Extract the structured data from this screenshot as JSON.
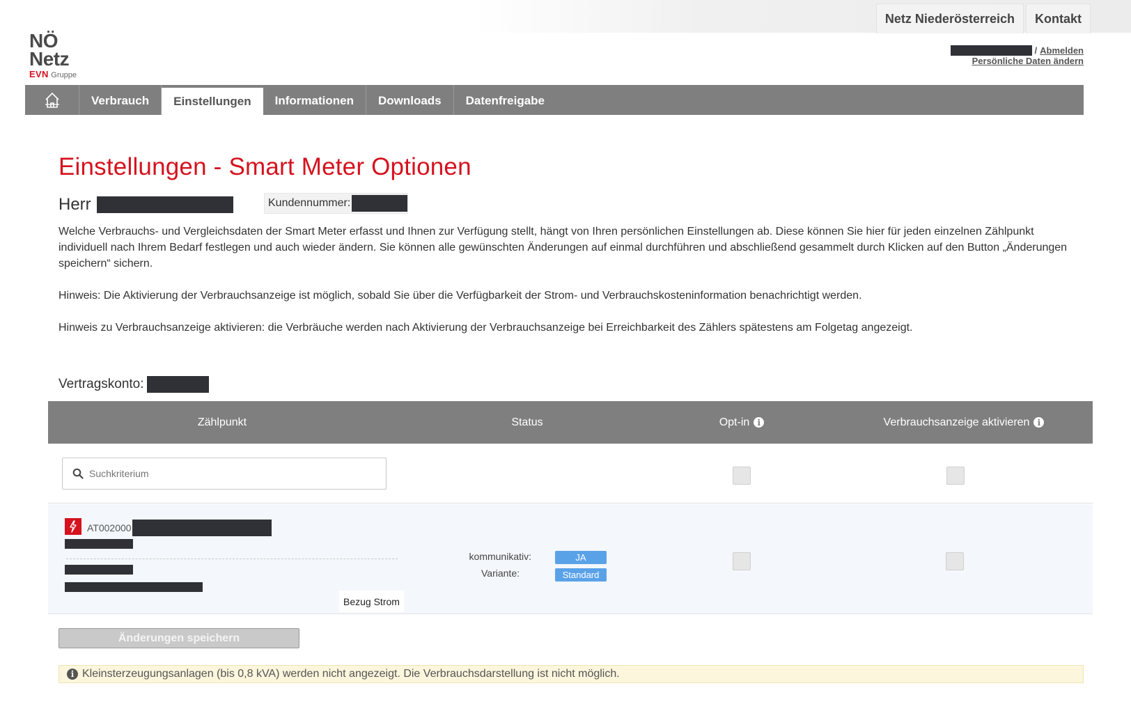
{
  "toplinks": [
    "Netz Niederösterreich",
    "Kontakt"
  ],
  "logo": {
    "line1": "NÖ",
    "line2": "Netz",
    "brand": "EVN",
    "brand_suffix": "Gruppe"
  },
  "user": {
    "logout": "Abmelden",
    "edit_data": "Persönliche Daten ändern",
    "separator": "/"
  },
  "nav": {
    "home_icon": "home-icon",
    "items": [
      {
        "label": "Verbrauch",
        "active": false
      },
      {
        "label": "Einstellungen",
        "active": true
      },
      {
        "label": "Informationen",
        "active": false
      },
      {
        "label": "Downloads",
        "active": false
      },
      {
        "label": "Datenfreigabe",
        "active": false
      }
    ]
  },
  "page": {
    "title": "Einstellungen - Smart Meter Optionen",
    "salutation": "Herr",
    "customer_number_label": "Kundennummer:",
    "intro": [
      "Welche Verbrauchs- und Vergleichsdaten der Smart Meter erfasst und Ihnen zur Verfügung stellt, hängt von Ihren persönlichen Einstellungen ab. Diese können Sie hier für jeden einzelnen Zählpunkt individuell nach Ihrem Bedarf festlegen und auch wieder ändern. Sie können alle gewünschten Änderungen auf einmal durchführen und abschließend gesammelt durch Klicken auf den Button „Änderungen speichern“ sichern.",
      "Hinweis: Die Aktivierung der Verbrauchsanzeige ist möglich, sobald Sie über die Verfügbarkeit der Strom- und Verbrauchskosteninformation benachrichtigt werden.",
      "Hinweis zu Verbrauchsanzeige aktivieren: die Verbräuche werden nach Aktivierung der Verbrauchsanzeige bei Erreichbarkeit des Zählers spätestens am Folgetag angezeigt."
    ],
    "contract_label": "Vertragskonto:"
  },
  "table": {
    "headers": {
      "zaehlpunkt": "Zählpunkt",
      "status": "Status",
      "optin": "Opt-in",
      "verbrauchsanzeige": "Verbrauchsanzeige aktivieren"
    },
    "search_placeholder": "Suchkriterium",
    "row": {
      "zaehlpunkt_prefix": "AT002000",
      "kommunikativ_label": "kommunikativ:",
      "kommunikativ_value": "JA",
      "variante_label": "Variante:",
      "variante_value": "Standard",
      "type_label": "Bezug Strom"
    }
  },
  "save_button": "Änderungen speichern",
  "notice": "Kleinsterzeugungsanlagen (bis 0,8 kVA) werden nicht angezeigt. Die Verbrauchsdarstellung ist nicht möglich.",
  "colors": {
    "brand_red": "#d5121e",
    "nav_gray": "#7f7f7f",
    "badge_blue": "#5aa2e8",
    "notice_bg": "#fbf6dc"
  }
}
